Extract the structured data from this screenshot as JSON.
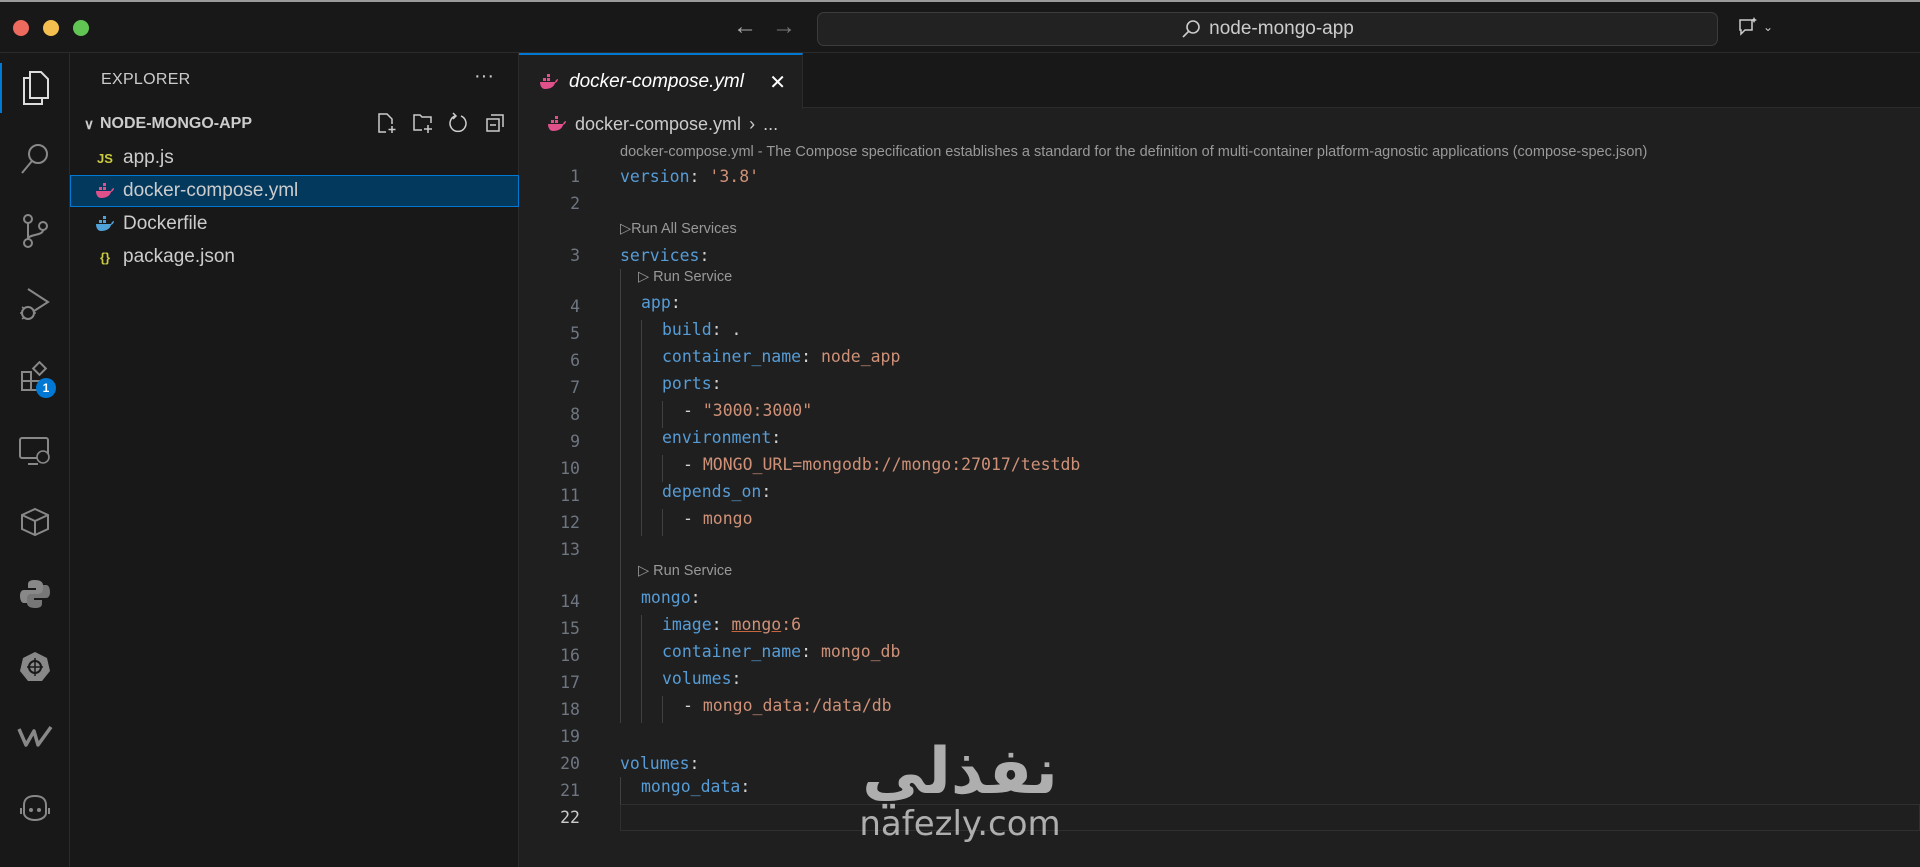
{
  "titlebar": {
    "search_text": "node-mongo-app",
    "back": "←",
    "forward": "→"
  },
  "activity_bar": {
    "extensions_badge": "1"
  },
  "sidebar": {
    "title": "EXPLORER",
    "more": "···",
    "folder": "NODE-MONGO-APP",
    "files": [
      {
        "name": "app.js",
        "icon": "JS"
      },
      {
        "name": "docker-compose.yml",
        "icon": "docker"
      },
      {
        "name": "Dockerfile",
        "icon": "docker"
      },
      {
        "name": "package.json",
        "icon": "{}"
      }
    ]
  },
  "editor": {
    "tab_label": "docker-compose.yml",
    "breadcrumb_file": "docker-compose.yml",
    "breadcrumb_more": "...",
    "schema_hint": "docker-compose.yml - The Compose specification establishes a standard for the definition of multi-container platform-agnostic applications (compose-spec.json)",
    "rows": [
      {
        "n": "1",
        "g": 0,
        "t": [
          [
            "version",
            "k"
          ],
          [
            ": ",
            "p"
          ],
          [
            "'3.8'",
            "s"
          ]
        ]
      },
      {
        "n": "2",
        "g": 0,
        "t": []
      },
      {
        "lens": "▷Run All Services",
        "g": 0
      },
      {
        "n": "3",
        "g": 0,
        "t": [
          [
            "services",
            "k"
          ],
          [
            ":",
            "p"
          ]
        ]
      },
      {
        "lens": "▷ Run Service",
        "g": 1
      },
      {
        "n": "4",
        "g": 1,
        "t": [
          [
            "app",
            "k"
          ],
          [
            ":",
            "p"
          ]
        ]
      },
      {
        "n": "5",
        "g": 2,
        "t": [
          [
            "build",
            "k"
          ],
          [
            ": .",
            "p"
          ]
        ]
      },
      {
        "n": "6",
        "g": 2,
        "t": [
          [
            "container_name",
            "k"
          ],
          [
            ": ",
            "p"
          ],
          [
            "node_app",
            "s"
          ]
        ]
      },
      {
        "n": "7",
        "g": 2,
        "t": [
          [
            "ports",
            "k"
          ],
          [
            ":",
            "p"
          ]
        ]
      },
      {
        "n": "8",
        "g": 3,
        "t": [
          [
            "- ",
            "p"
          ],
          [
            "\"3000:3000\"",
            "s"
          ]
        ]
      },
      {
        "n": "9",
        "g": 2,
        "t": [
          [
            "environment",
            "k"
          ],
          [
            ":",
            "p"
          ]
        ]
      },
      {
        "n": "10",
        "g": 3,
        "t": [
          [
            "- ",
            "p"
          ],
          [
            "MONGO_URL=mongodb://mongo:27017/testdb",
            "s"
          ]
        ]
      },
      {
        "n": "11",
        "g": 2,
        "t": [
          [
            "depends_on",
            "k"
          ],
          [
            ":",
            "p"
          ]
        ]
      },
      {
        "n": "12",
        "g": 3,
        "t": [
          [
            "- ",
            "p"
          ],
          [
            "mongo",
            "s"
          ]
        ]
      },
      {
        "n": "13",
        "g": 1,
        "t": []
      },
      {
        "lens": "▷ Run Service",
        "g": 1
      },
      {
        "n": "14",
        "g": 1,
        "t": [
          [
            "mongo",
            "k"
          ],
          [
            ":",
            "p"
          ]
        ]
      },
      {
        "n": "15",
        "g": 2,
        "t": [
          [
            "image",
            "k"
          ],
          [
            ": ",
            "p"
          ],
          [
            "mongo",
            "u"
          ],
          [
            ":6",
            "s"
          ]
        ]
      },
      {
        "n": "16",
        "g": 2,
        "t": [
          [
            "container_name",
            "k"
          ],
          [
            ": ",
            "p"
          ],
          [
            "mongo_db",
            "s"
          ]
        ]
      },
      {
        "n": "17",
        "g": 2,
        "t": [
          [
            "volumes",
            "k"
          ],
          [
            ":",
            "p"
          ]
        ]
      },
      {
        "n": "18",
        "g": 3,
        "t": [
          [
            "- ",
            "p"
          ],
          [
            "mongo_data:/data/db",
            "s"
          ]
        ]
      },
      {
        "n": "19",
        "g": 0,
        "t": []
      },
      {
        "n": "20",
        "g": 0,
        "t": [
          [
            "volumes",
            "k"
          ],
          [
            ":",
            "p"
          ]
        ]
      },
      {
        "n": "21",
        "g": 1,
        "t": [
          [
            "mongo_data",
            "k"
          ],
          [
            ":",
            "p"
          ]
        ]
      },
      {
        "n": "22",
        "g": 0,
        "t": [],
        "current": true
      }
    ]
  },
  "watermark": {
    "arabic": "نفذلي",
    "latin": "nafezly.com"
  },
  "colors": {
    "accent": "#0078d4",
    "key": "#569cd6",
    "string": "#ce9178",
    "docker_pink": "#e0508a",
    "docker_blue": "#4fa3d8",
    "js_yellow": "#cbcb41"
  }
}
